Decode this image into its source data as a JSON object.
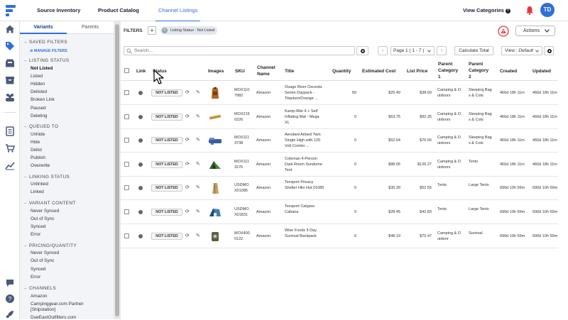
{
  "app": {
    "nav": {
      "source_inventory": "Source Inventory",
      "product_catalog": "Product Catalog",
      "channel_listings": "Channel Listings",
      "view_categories": "View Categories",
      "avatar_initials": "TD"
    },
    "brand_color": "#2f6fdb"
  },
  "sidebar": {
    "tabs": {
      "variants": "Variants",
      "parents": "Parents"
    },
    "saved_filters": {
      "title": "SAVED FILTERS",
      "manage": "MANAGE FILTERS"
    },
    "listing_status": {
      "title": "LISTING STATUS",
      "items": [
        "Not Listed",
        "Listed",
        "Hidden",
        "Delisted",
        "Broken Link",
        "Paused",
        "Deleting"
      ],
      "selected": "Not Listed"
    },
    "queued_to": {
      "title": "QUEUED TO",
      "items": [
        "Unhide",
        "Hide",
        "Delist",
        "Publish",
        "Overwrite"
      ]
    },
    "linking_status": {
      "title": "LINKING STATUS",
      "items": [
        "Unlinked",
        "Linked"
      ]
    },
    "variant_content": {
      "title": "VARIANT CONTENT",
      "items": [
        "Never Synced",
        "Out of Sync",
        "Synced",
        "Error"
      ]
    },
    "pricing_quantity": {
      "title": "PRICING/QUANTITY",
      "items": [
        "Never Synced",
        "Out of Sync",
        "Synced",
        "Error"
      ]
    },
    "channels": {
      "title": "CHANNELS",
      "items": [
        "Amazon",
        "Campinggear.com Partner [Shipstation]",
        "DueEastOutfitters.com"
      ]
    }
  },
  "toolbar": {
    "filters_label": "FILTERS",
    "chip_label": "Listing Status : Not Listed",
    "actions_label": "Actions",
    "search_placeholder": "Search...",
    "page_label": "Page 1 ( 1 - 7 )",
    "calc_total": "Calculate Total",
    "view_prefix": "View : ",
    "view_value": "Default"
  },
  "table": {
    "headers": {
      "link": "Link",
      "status": "Status",
      "images": "Images",
      "sku": "SKU",
      "channel_name_1": "Channel",
      "channel_name_2": "Name",
      "title": "Title",
      "quantity": "Quantity",
      "est_cost": "Estimated Cost",
      "list_price": "List Price",
      "parent_cat1_1": "Parent",
      "parent_cat1_2": "Category",
      "parent_cat1_3": "1",
      "parent_cat2_1": "Parent",
      "parent_cat2_2": "Category",
      "parent_cat2_3": "2",
      "created": "Created",
      "updated": "Updated"
    },
    "rows": [
      {
        "status": "NOT LISTED",
        "image": "backpack",
        "sku1": "MOX110",
        "sku2": "7982",
        "channel": "Amazon",
        "title1": "Osage River Osceola",
        "title2": "Series Daypack -",
        "title3": "Titanium/Orange ...",
        "qty": "50",
        "cost": "$25.49",
        "price": "$38.69",
        "cat1a": "Camping & O",
        "cat1b": "utdoors",
        "cat2a": "Sleeping Bag",
        "cat2b": "s & Cots",
        "created": "466d 18h 11m",
        "updated": "466d 18h 11m"
      },
      {
        "status": "NOT LISTED",
        "image": "pad",
        "sku1": "MOX216",
        "sku2": "0226",
        "channel": "Amazon",
        "title1": "Kamp-Rite 4 + Self",
        "title2": "Inflating Mat - Mega",
        "title3": "XL",
        "qty": "0",
        "cost": "$63.75",
        "price": "$92.25",
        "cat1a": "Camping & O",
        "cat1b": "utdoors",
        "cat2a": "Sleeping Bag",
        "cat2b": "s & Cots",
        "created": "466d 18h 11m",
        "updated": "466d 18h 11m"
      },
      {
        "status": "NOT LISTED",
        "image": "bed",
        "sku1": "MOX111",
        "sku2": "3738",
        "channel": "Amazon",
        "title1": "Aerobed Airbed Twin",
        "title2": "Single High with 120",
        "title3": "Volt Combo ...",
        "qty": "0",
        "cost": "$52.54",
        "price": "$76.56",
        "cat1a": "Camping & O",
        "cat1b": "utdoors",
        "cat2a": "Sleeping Bag",
        "cat2b": "s & Cots",
        "created": "466d 18h 11m",
        "updated": "466d 18h 11m"
      },
      {
        "status": "NOT LISTED",
        "image": "tent",
        "sku1": "MOX111",
        "sku2": "3276",
        "channel": "Amazon",
        "title1": "Coleman 4-Person",
        "title2": "Dark Room Sundome",
        "title3": "Tent",
        "qty": "0",
        "cost": "$88.05",
        "price": "$126.27",
        "cat1a": "Camping & O",
        "cat1b": "utdoors",
        "cat2a": "Tents",
        "cat2b": "",
        "created": "466d 18h 11m",
        "updated": "466d 18h 11m"
      },
      {
        "status": "NOT LISTED",
        "image": "shelter",
        "sku1": "USDMO",
        "sku2": "X01085",
        "channel": "Amazon",
        "title1": "Texsport Privacy",
        "title2": "Shelter Hilo Hut 01085",
        "title3": "",
        "qty": "0",
        "cost": "$35.39",
        "price": "$52.55",
        "cat1a": "Tents",
        "cat1b": "",
        "cat2a": "Large Tents",
        "cat2b": "",
        "created": "690d 10h 59m",
        "updated": "690d 10h 59m"
      },
      {
        "status": "NOT LISTED",
        "image": "cabana",
        "sku1": "USDMO",
        "sku2": "X01831",
        "channel": "Amazon",
        "title1": "Texsport Calypso",
        "title2": "Cabana",
        "title3": "",
        "qty": "0",
        "cost": "$28.45",
        "price": "$42.83",
        "cat1a": "Tents",
        "cat1b": "",
        "cat2a": "Large Tents",
        "cat2b": "",
        "created": "690d 10h 59m",
        "updated": "690d 10h 59m"
      },
      {
        "status": "NOT LISTED",
        "image": "survival",
        "sku1": "MOX400",
        "sku2": "0122",
        "channel": "Amazon",
        "title1": "Wise Foods 5 Day",
        "title2": "Survival Backpack",
        "title3": "",
        "qty": "6",
        "cost": "$48.19",
        "price": "$70.47",
        "cat1a": "Camping & O",
        "cat1b": "utdoor",
        "cat2a": "Survival",
        "cat2b": "",
        "created": "690d 10h 59m",
        "updated": "690d 10h 59m"
      }
    ]
  }
}
